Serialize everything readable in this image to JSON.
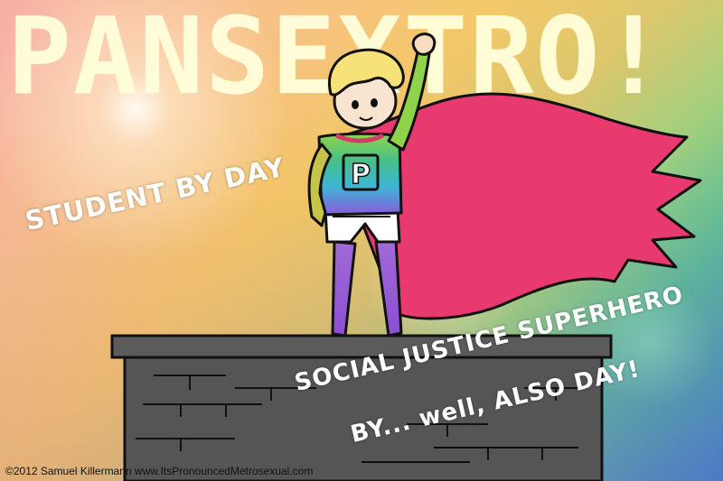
{
  "title": "PANSEXTRO!",
  "captions": {
    "day": "STUDENT BY DAY",
    "hero_line1": "SOCIAL JUSTICE SUPERHERO",
    "hero_line2": "BY... well, ALSO DAY!"
  },
  "chest_emblem": "P",
  "copyright": "©2012 Samuel Killermann www.ItsPronouncedMetrosexual.com",
  "colors": {
    "cape": "#e83a6e",
    "hair": "#f7e27a",
    "rooftop": "#555555",
    "title_text": "#fffdd7",
    "rainbow_top": "#8fd34a",
    "rainbow_mid": "#3fb5d6",
    "rainbow_bottom": "#8b5ad9"
  }
}
